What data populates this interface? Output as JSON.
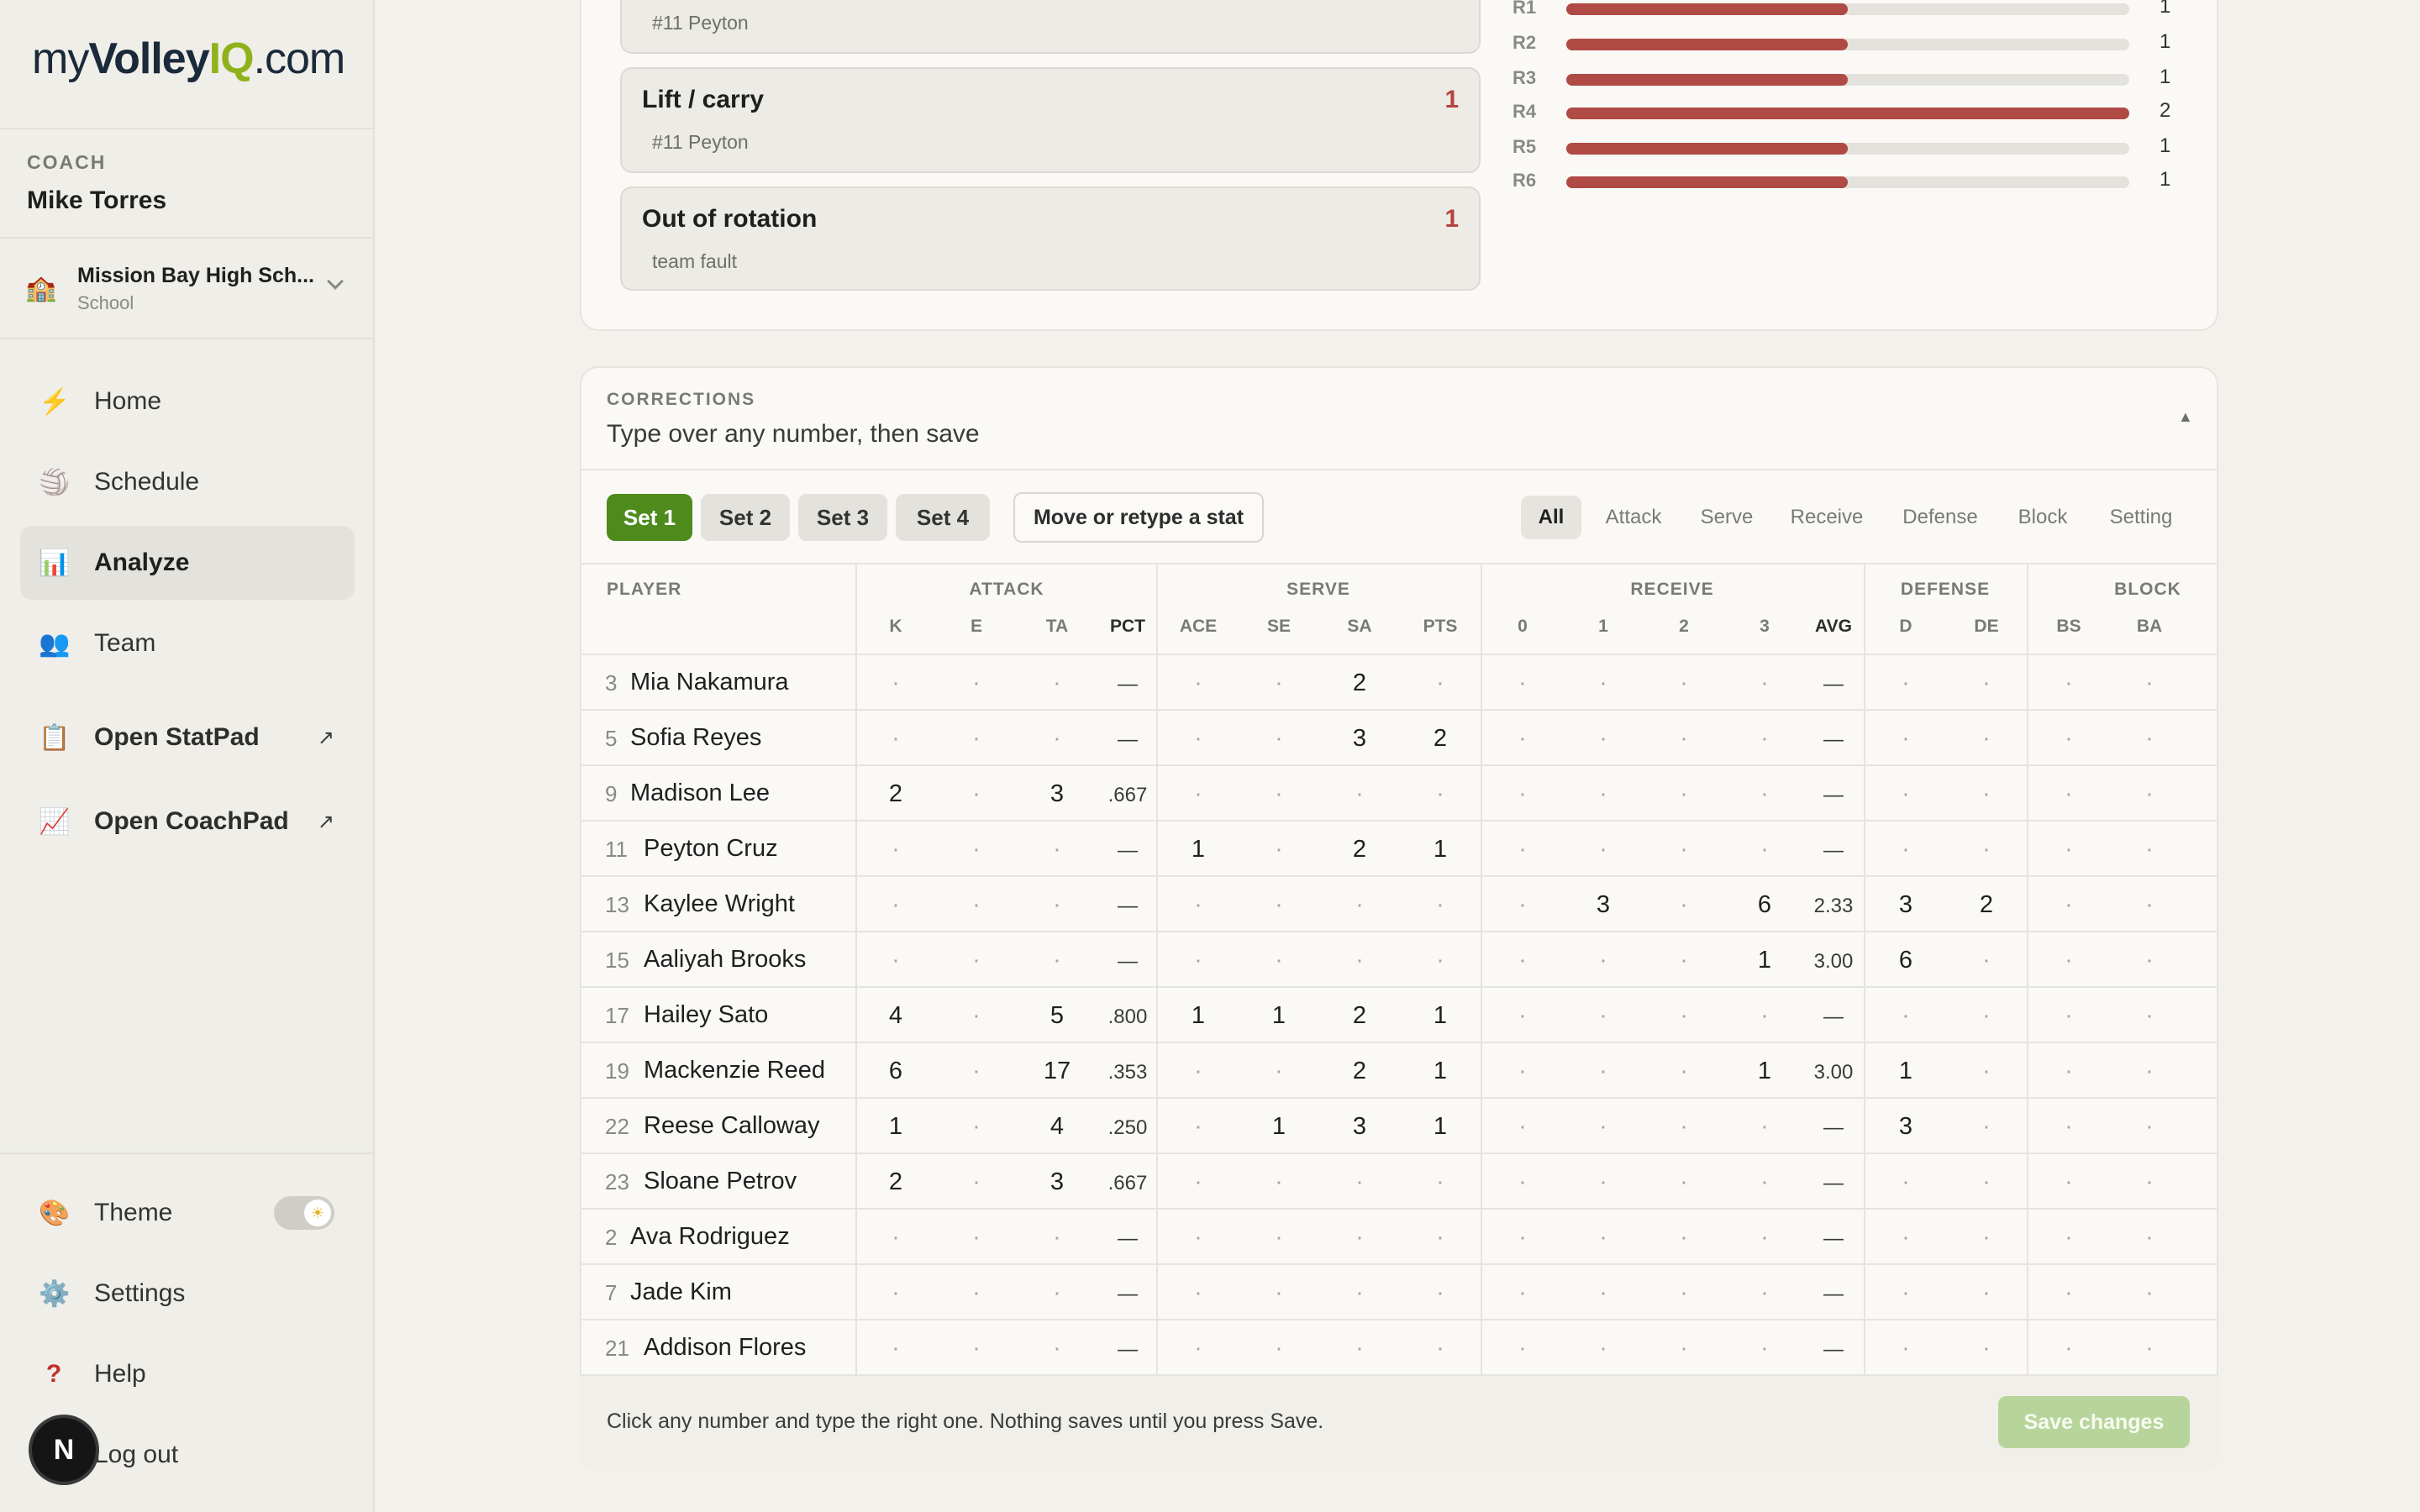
{
  "brand": {
    "my": "my",
    "volley": "Volley",
    "iq": "IQ",
    "com": ".com"
  },
  "user": {
    "role": "COACH",
    "name": "Mike Torres"
  },
  "school": {
    "name": "Mission Bay High Sch...",
    "type": "School",
    "icon": "school-icon"
  },
  "nav": {
    "home": "Home",
    "schedule": "Schedule",
    "analyze": "Analyze",
    "team": "Team",
    "statpad": "Open StatPad",
    "coachpad": "Open CoachPad",
    "ext_arrow": "↗",
    "theme": "Theme",
    "settings": "Settings",
    "help": "Help",
    "logout": "Log out",
    "badge": "N"
  },
  "faults": [
    {
      "title": "",
      "count": "",
      "sub": "#11 Peyton"
    },
    {
      "title": "Lift / carry",
      "count": "1",
      "sub": "#11 Peyton"
    },
    {
      "title": "Out of rotation",
      "count": "1",
      "sub": "team fault"
    }
  ],
  "rotations": [
    {
      "label": "R1",
      "value": "1",
      "fraction": 0.5
    },
    {
      "label": "R2",
      "value": "1",
      "fraction": 0.5
    },
    {
      "label": "R3",
      "value": "1",
      "fraction": 0.5
    },
    {
      "label": "R4",
      "value": "2",
      "fraction": 1.0
    },
    {
      "label": "R5",
      "value": "1",
      "fraction": 0.5
    },
    {
      "label": "R6",
      "value": "1",
      "fraction": 0.5
    }
  ],
  "accent": {
    "green": "#4e8a1c",
    "red": "#b04a45"
  },
  "corrections": {
    "kicker": "CORRECTIONS",
    "title": "Type over any number, then save",
    "caret": "▲",
    "sets": [
      "Set 1",
      "Set 2",
      "Set 3",
      "Set 4"
    ],
    "active_set": "Set 1",
    "move_button": "Move or retype a stat",
    "filters": [
      "All",
      "Attack",
      "Serve",
      "Receive",
      "Defense",
      "Block",
      "Setting"
    ],
    "active_filter": "All",
    "footer_text": "Click any number and type the right one. Nothing saves until you press Save.",
    "save_button": "Save changes"
  },
  "table": {
    "player_header": "PLAYER",
    "groups": [
      "ATTACK",
      "SERVE",
      "RECEIVE",
      "DEFENSE",
      "BLOCK"
    ],
    "columns": [
      "K",
      "E",
      "TA",
      "PCT",
      "ACE",
      "SE",
      "SA",
      "PTS",
      "0",
      "1",
      "2",
      "3",
      "AVG",
      "D",
      "DE",
      "BS",
      "BA"
    ],
    "rows": [
      {
        "num": "3",
        "name": "Mia Nakamura",
        "cells": [
          "·",
          "·",
          "·",
          "—",
          "·",
          "·",
          "2",
          "·",
          "·",
          "·",
          "·",
          "·",
          "—",
          "·",
          "·",
          "·",
          "·"
        ]
      },
      {
        "num": "5",
        "name": "Sofia Reyes",
        "cells": [
          "·",
          "·",
          "·",
          "—",
          "·",
          "·",
          "3",
          "2",
          "·",
          "·",
          "·",
          "·",
          "—",
          "·",
          "·",
          "·",
          "·"
        ]
      },
      {
        "num": "9",
        "name": "Madison Lee",
        "cells": [
          "2",
          "·",
          "3",
          ".667",
          "·",
          "·",
          "·",
          "·",
          "·",
          "·",
          "·",
          "·",
          "—",
          "·",
          "·",
          "·",
          "·"
        ]
      },
      {
        "num": "11",
        "name": "Peyton Cruz",
        "cells": [
          "·",
          "·",
          "·",
          "—",
          "1",
          "·",
          "2",
          "1",
          "·",
          "·",
          "·",
          "·",
          "—",
          "·",
          "·",
          "·",
          "·"
        ]
      },
      {
        "num": "13",
        "name": "Kaylee Wright",
        "cells": [
          "·",
          "·",
          "·",
          "—",
          "·",
          "·",
          "·",
          "·",
          "·",
          "3",
          "·",
          "6",
          "2.33",
          "3",
          "2",
          "·",
          "·"
        ]
      },
      {
        "num": "15",
        "name": "Aaliyah Brooks",
        "cells": [
          "·",
          "·",
          "·",
          "—",
          "·",
          "·",
          "·",
          "·",
          "·",
          "·",
          "·",
          "1",
          "3.00",
          "6",
          "·",
          "·",
          "·"
        ]
      },
      {
        "num": "17",
        "name": "Hailey Sato",
        "cells": [
          "4",
          "·",
          "5",
          ".800",
          "1",
          "1",
          "2",
          "1",
          "·",
          "·",
          "·",
          "·",
          "—",
          "·",
          "·",
          "·",
          "·"
        ]
      },
      {
        "num": "19",
        "name": "Mackenzie Reed",
        "cells": [
          "6",
          "·",
          "17",
          ".353",
          "·",
          "·",
          "2",
          "1",
          "·",
          "·",
          "·",
          "1",
          "3.00",
          "1",
          "·",
          "·",
          "·"
        ]
      },
      {
        "num": "22",
        "name": "Reese Calloway",
        "cells": [
          "1",
          "·",
          "4",
          ".250",
          "·",
          "1",
          "3",
          "1",
          "·",
          "·",
          "·",
          "·",
          "—",
          "3",
          "·",
          "·",
          "·"
        ]
      },
      {
        "num": "23",
        "name": "Sloane Petrov",
        "cells": [
          "2",
          "·",
          "3",
          ".667",
          "·",
          "·",
          "·",
          "·",
          "·",
          "·",
          "·",
          "·",
          "—",
          "·",
          "·",
          "·",
          "·"
        ]
      },
      {
        "num": "2",
        "name": "Ava Rodriguez",
        "cells": [
          "·",
          "·",
          "·",
          "—",
          "·",
          "·",
          "·",
          "·",
          "·",
          "·",
          "·",
          "·",
          "—",
          "·",
          "·",
          "·",
          "·"
        ]
      },
      {
        "num": "7",
        "name": "Jade Kim",
        "cells": [
          "·",
          "·",
          "·",
          "—",
          "·",
          "·",
          "·",
          "·",
          "·",
          "·",
          "·",
          "·",
          "—",
          "·",
          "·",
          "·",
          "·"
        ]
      },
      {
        "num": "21",
        "name": "Addison Flores",
        "cells": [
          "·",
          "·",
          "·",
          "—",
          "·",
          "·",
          "·",
          "·",
          "·",
          "·",
          "·",
          "·",
          "—",
          "·",
          "·",
          "·",
          "·"
        ]
      }
    ]
  }
}
